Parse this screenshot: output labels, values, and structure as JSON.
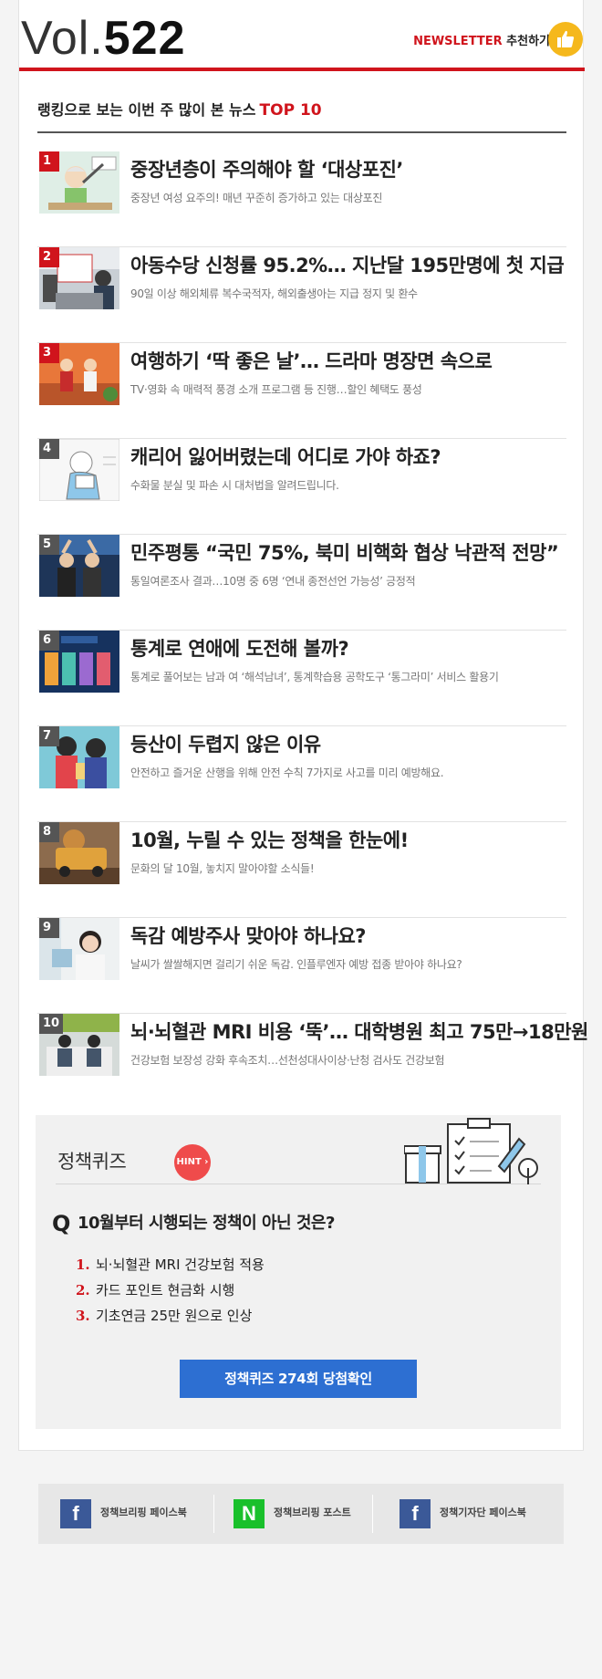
{
  "header": {
    "vol_label": "Vol.",
    "vol_number": "522",
    "newsletter_label": "NEWSLETTER",
    "recommend_label": "추천하기"
  },
  "ranking": {
    "title": "랭킹으로 보는 이번 주 많이 본 뉴스",
    "title_badge": "TOP 10",
    "rank_color": "#d0141c",
    "items": [
      {
        "rank": "1",
        "headline": "중장년층이 주의해야 할 ‘대상포진’",
        "summary": "중장년 여성 요주의! 매년 꾸준히 증가하고 있는 대상포진",
        "thumb": "illustration-elderly-man"
      },
      {
        "rank": "2",
        "headline": "아동수당 신청률 95.2%… 지난달 195만명에 첫 지급",
        "summary": "90일 이상 해외체류 복수국적자, 해외출생아는 지급 정지 및 환수",
        "thumb": "photo-office-desk"
      },
      {
        "rank": "3",
        "headline": "여행하기 ‘딱 좋은 날’… 드라마 명장면 속으로",
        "summary": "TV·영화 속 매력적 풍경 소개 프로그램 등 진행…할인 혜택도 풍성",
        "thumb": "illustration-travel-couple"
      },
      {
        "rank": "4",
        "headline": "캐리어 잃어버렸는데 어디로 가야 하죠?",
        "summary": "수화물 분실 및 파손 시 대처법을 알려드립니다.",
        "thumb": "illustration-man-reading"
      },
      {
        "rank": "5",
        "headline": "민주평통 “국민 75%, 북미 비핵화 협상 낙관적 전망”",
        "summary": "통일여론조사 결과…10명 중 6명 ‘연내 종전선언 가능성’ 긍정적",
        "thumb": "photo-leaders-handshake"
      },
      {
        "rank": "6",
        "headline": "통계로 연애에 도전해 볼까?",
        "summary": "통계로 풀어보는 남과 여 ‘해석남녀’, 통계학습용 공학도구 ‘통그라미’ 서비스 활용기",
        "thumb": "graphic-statistics-cards"
      },
      {
        "rank": "7",
        "headline": "등산이 두렵지 않은 이유",
        "summary": "안전하고 즐거운 산행을 위해 안전 수칙 7가지로 사고를 미리 예방해요.",
        "thumb": "illustration-hikers"
      },
      {
        "rank": "8",
        "headline": "10월, 누릴 수 있는 정책을 한눈에!",
        "summary": "문화의 달 10월, 놓치지 말아야할 소식들!",
        "thumb": "photo-toy-van"
      },
      {
        "rank": "9",
        "headline": "독감 예방주사 맞아야 하나요?",
        "summary": "날씨가 쌀쌀해지면 걸리기 쉬운 독감. 인플루엔자 예방 접종 받아야 하나요?",
        "thumb": "photo-vaccination"
      },
      {
        "rank": "10",
        "headline": "뇌·뇌혈관 MRI 비용 ‘뚝’… 대학병원 최고 75만→18만원",
        "summary": "건강보험 보장성 강화 후속조치…선천성대사이상·난청 검사도 건강보험",
        "thumb": "photo-hospital-reception"
      }
    ]
  },
  "quiz": {
    "title": "정책퀴즈",
    "hint_label": "HINT",
    "question_mark": "Q",
    "question": "10월부터 시행되는 정책이 아닌 것은?",
    "options": [
      {
        "num": "1.",
        "text": "뇌·뇌혈관 MRI 건강보험 적용"
      },
      {
        "num": "2.",
        "text": "카드 포인트 현금화 시행"
      },
      {
        "num": "3.",
        "text": "기초연금 25만 원으로 인상"
      }
    ],
    "button_label": "정책퀴즈 274회 당첨확인",
    "button_color": "#2d6fd2"
  },
  "social": {
    "links": [
      {
        "icon": "facebook-icon",
        "glyph": "f",
        "label": "정책브리핑 페이스북",
        "color": "#3b5998"
      },
      {
        "icon": "naver-post-icon",
        "glyph": "N",
        "label": "정책브리핑 포스트",
        "color": "#19c02b"
      },
      {
        "icon": "facebook-icon",
        "glyph": "f",
        "label": "정책기자단 페이스북",
        "color": "#3b5998"
      }
    ]
  }
}
